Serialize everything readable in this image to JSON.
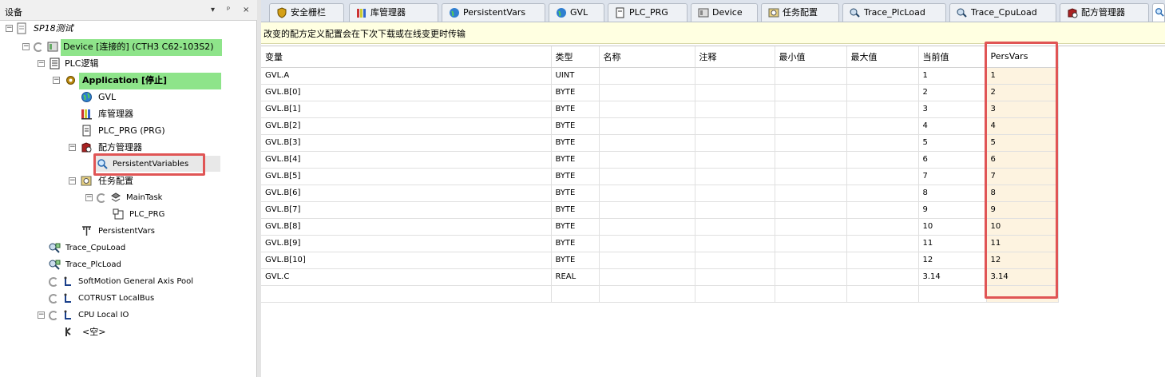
{
  "devices_panel": {
    "title": "设备",
    "buttons": [
      "▾",
      "ᵖ",
      "×"
    ],
    "tree": [
      {
        "label": "SP18测试",
        "icon": "project-icon",
        "level": 0
      },
      {
        "label": "Device [连接的] (CTH3 C62-103S2)",
        "icon": "device-icon",
        "level": 1
      },
      {
        "label": "PLC逻辑",
        "icon": "plc-logic-icon",
        "level": 2
      },
      {
        "label": "Application [停止]",
        "icon": "application-gear-icon",
        "level": 3
      },
      {
        "label": "GVL",
        "icon": "globe-icon",
        "level": 4
      },
      {
        "label": "库管理器",
        "icon": "library-icon",
        "level": 4
      },
      {
        "label": "PLC_PRG (PRG)",
        "icon": "document-icon",
        "level": 4
      },
      {
        "label": "配方管理器",
        "icon": "recipe-manager-icon",
        "level": 4
      },
      {
        "label": "PersistentVariables",
        "icon": "magnifier-icon",
        "level": 5
      },
      {
        "label": "任务配置",
        "icon": "task-config-icon",
        "level": 4
      },
      {
        "label": "MainTask",
        "icon": "task-icon",
        "level": 5
      },
      {
        "label": "PLC_PRG",
        "icon": "program-icon",
        "level": 6
      },
      {
        "label": "PersistentVars",
        "icon": "persistent-vars-icon",
        "level": 4
      },
      {
        "label": "Trace_CpuLoad",
        "icon": "trace-icon",
        "level": 3
      },
      {
        "label": "Trace_PlcLoad",
        "icon": "trace-icon",
        "level": 3
      },
      {
        "label": "SoftMotion General Axis Pool",
        "icon": "axis-pool-icon",
        "level": 3
      },
      {
        "label": "COTRUST LocalBus",
        "icon": "bus-icon",
        "level": 3
      },
      {
        "label": "CPU Local IO",
        "icon": "io-icon",
        "level": 3
      },
      {
        "label": "<空>",
        "icon": "empty-slot-icon",
        "level": 4
      }
    ]
  },
  "tabs": [
    {
      "label": "安全栅栏",
      "icon": "shield-icon"
    },
    {
      "label": "库管理器",
      "icon": "library-icon"
    },
    {
      "label": "PersistentVars",
      "icon": "globe-icon"
    },
    {
      "label": "GVL",
      "icon": "globe-icon"
    },
    {
      "label": "PLC_PRG",
      "icon": "document-icon"
    },
    {
      "label": "Device",
      "icon": "device-icon"
    },
    {
      "label": "任务配置",
      "icon": "task-config-icon"
    },
    {
      "label": "Trace_PlcLoad",
      "icon": "trace-icon"
    },
    {
      "label": "Trace_CpuLoad",
      "icon": "trace-icon"
    },
    {
      "label": "配方管理器",
      "icon": "recipe-manager-icon"
    }
  ],
  "info_message": "改变的配方定义配置会在下次下载或在线变更时传输",
  "recipe_table": {
    "columns": [
      "变量",
      "类型",
      "名称",
      "注释",
      "最小值",
      "最大值",
      "当前值",
      "PersVars"
    ],
    "rows": [
      [
        "GVL.A",
        "UINT",
        "",
        "",
        "",
        "",
        "1",
        "1"
      ],
      [
        "GVL.B[0]",
        "BYTE",
        "",
        "",
        "",
        "",
        "2",
        "2"
      ],
      [
        "GVL.B[1]",
        "BYTE",
        "",
        "",
        "",
        "",
        "3",
        "3"
      ],
      [
        "GVL.B[2]",
        "BYTE",
        "",
        "",
        "",
        "",
        "4",
        "4"
      ],
      [
        "GVL.B[3]",
        "BYTE",
        "",
        "",
        "",
        "",
        "5",
        "5"
      ],
      [
        "GVL.B[4]",
        "BYTE",
        "",
        "",
        "",
        "",
        "6",
        "6"
      ],
      [
        "GVL.B[5]",
        "BYTE",
        "",
        "",
        "",
        "",
        "7",
        "7"
      ],
      [
        "GVL.B[6]",
        "BYTE",
        "",
        "",
        "",
        "",
        "8",
        "8"
      ],
      [
        "GVL.B[7]",
        "BYTE",
        "",
        "",
        "",
        "",
        "9",
        "9"
      ],
      [
        "GVL.B[8]",
        "BYTE",
        "",
        "",
        "",
        "",
        "10",
        "10"
      ],
      [
        "GVL.B[9]",
        "BYTE",
        "",
        "",
        "",
        "",
        "11",
        "11"
      ],
      [
        "GVL.B[10]",
        "BYTE",
        "",
        "",
        "",
        "",
        "12",
        "12"
      ],
      [
        "GVL.C",
        "REAL",
        "",
        "",
        "",
        "",
        "3.14",
        "3.14"
      ]
    ]
  },
  "colors": {
    "highlight_green": "#8ee48a",
    "annotation_red": "#e05555",
    "info_yellow": "#ffffe1",
    "persvars_column": "#fdf3e0"
  }
}
